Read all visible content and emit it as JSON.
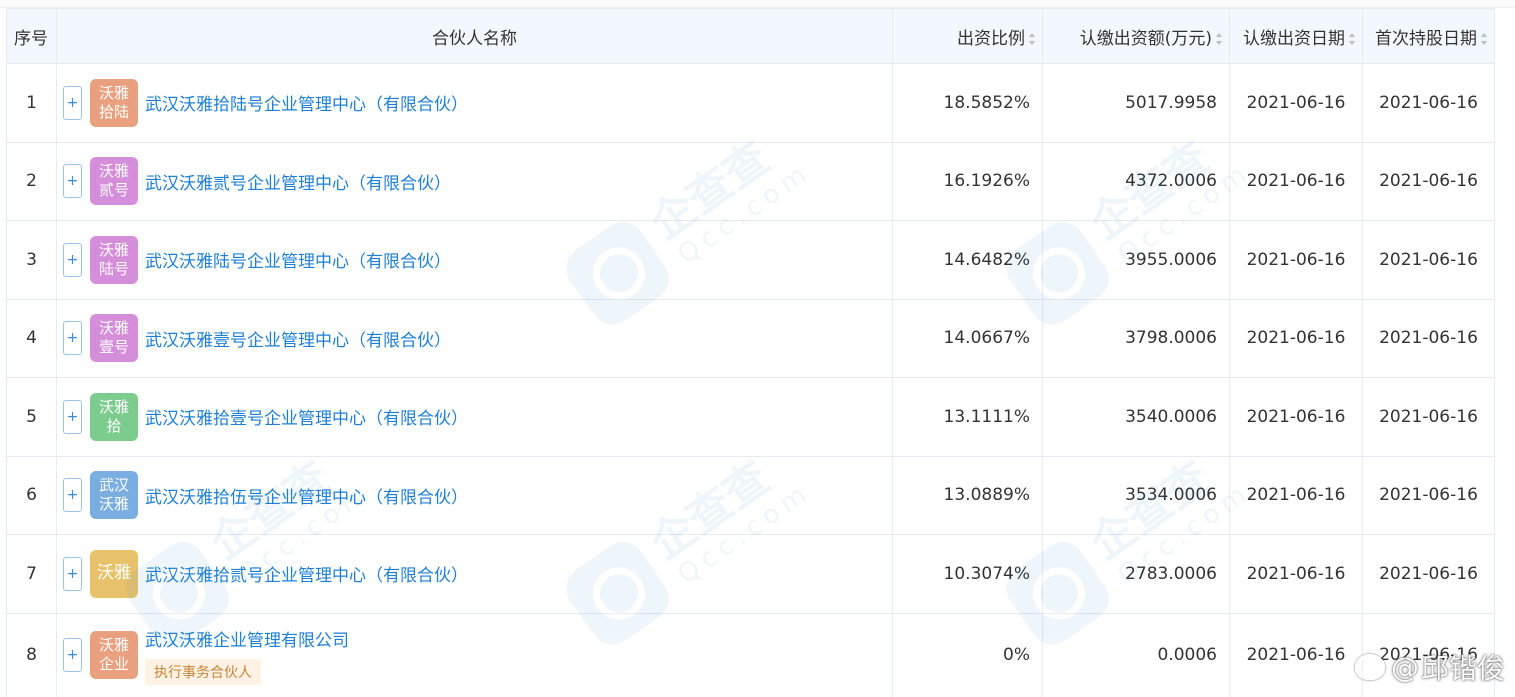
{
  "table": {
    "headers": {
      "index": "序号",
      "name": "合伙人名称",
      "ratio": "出资比例",
      "amount": "认缴出资额(万元)",
      "subscribe_date": "认缴出资日期",
      "first_hold_date": "首次持股日期"
    },
    "expand_symbol": "+",
    "rows": [
      {
        "index": "1",
        "logo_text": "沃雅拾陆",
        "logo_color": "#e8a07e",
        "name": "武汉沃雅拾陆号企业管理中心（有限合伙）",
        "ratio": "18.5852%",
        "amount": "5017.9958",
        "subscribe_date": "2021-06-16",
        "first_hold_date": "2021-06-16"
      },
      {
        "index": "2",
        "logo_text": "沃雅贰号",
        "logo_color": "#d58ed9",
        "name": "武汉沃雅贰号企业管理中心（有限合伙）",
        "ratio": "16.1926%",
        "amount": "4372.0006",
        "subscribe_date": "2021-06-16",
        "first_hold_date": "2021-06-16"
      },
      {
        "index": "3",
        "logo_text": "沃雅陆号",
        "logo_color": "#d58ed9",
        "name": "武汉沃雅陆号企业管理中心（有限合伙）",
        "ratio": "14.6482%",
        "amount": "3955.0006",
        "subscribe_date": "2021-06-16",
        "first_hold_date": "2021-06-16"
      },
      {
        "index": "4",
        "logo_text": "沃雅壹号",
        "logo_color": "#d58ed9",
        "name": "武汉沃雅壹号企业管理中心（有限合伙）",
        "ratio": "14.0667%",
        "amount": "3798.0006",
        "subscribe_date": "2021-06-16",
        "first_hold_date": "2021-06-16"
      },
      {
        "index": "5",
        "logo_text": "沃雅拾",
        "logo_color": "#7ccc8e",
        "name": "武汉沃雅拾壹号企业管理中心（有限合伙）",
        "ratio": "13.1111%",
        "amount": "3540.0006",
        "subscribe_date": "2021-06-16",
        "first_hold_date": "2021-06-16"
      },
      {
        "index": "6",
        "logo_text": "武汉沃雅",
        "logo_color": "#7aaee0",
        "name": "武汉沃雅拾伍号企业管理中心（有限合伙）",
        "ratio": "13.0889%",
        "amount": "3534.0006",
        "subscribe_date": "2021-06-16",
        "first_hold_date": "2021-06-16"
      },
      {
        "index": "7",
        "logo_text": "沃雅",
        "logo_color": "#e8c26a",
        "name": "武汉沃雅拾贰号企业管理中心（有限合伙）",
        "ratio": "10.3074%",
        "amount": "2783.0006",
        "subscribe_date": "2021-06-16",
        "first_hold_date": "2021-06-16"
      },
      {
        "index": "8",
        "logo_text": "沃雅企业",
        "logo_color": "#e8a07e",
        "name": "武汉沃雅企业管理有限公司",
        "badge": "执行事务合伙人",
        "ratio": "0%",
        "amount": "0.0006",
        "subscribe_date": "2021-06-16",
        "first_hold_date": "2021-06-16"
      }
    ]
  },
  "watermark": {
    "brand": "企查查",
    "domain": "Qcc.com"
  },
  "weibo_mark": {
    "at": "@",
    "name": "邱锴俊"
  }
}
